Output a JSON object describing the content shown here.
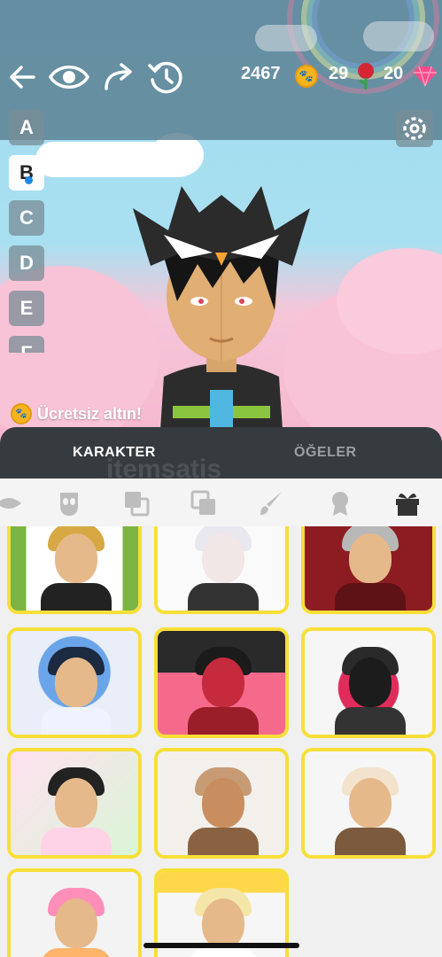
{
  "header": {
    "coins": "2467",
    "roses": "29",
    "gems": "20"
  },
  "letters": [
    "A",
    "B",
    "C",
    "D",
    "E",
    "F"
  ],
  "free_coins_label": "Ücretsiz altın!",
  "tabs": [
    "KARAKTER",
    "ÖĞELER"
  ],
  "watermark": "itemsatis",
  "categories": [
    "lips-icon",
    "mask-icon",
    "layers-icon",
    "layer-front-icon",
    "brush-icon",
    "award-icon",
    "gift-icon"
  ],
  "cards": [
    {
      "theme": "sunflower",
      "hair": "#d7a843",
      "body": "#222"
    },
    {
      "theme": "butterfly",
      "hair": "#e8e8ee",
      "body": "#333"
    },
    {
      "theme": "playing-cards",
      "hair": "#b8b8b8",
      "body": "#7a1c1c"
    },
    {
      "theme": "blue-crown",
      "hair": "#1b2a40",
      "body": "#eef3ff"
    },
    {
      "theme": "red-oni",
      "hair": "#1b1b1b",
      "body": "#c52b3c"
    },
    {
      "theme": "dark-mask",
      "hair": "#2a2a2a",
      "body": "#e02c5b"
    },
    {
      "theme": "candy",
      "hair": "#222",
      "body": "#ffd3e6"
    },
    {
      "theme": "teddy-bear",
      "hair": "#c79b74",
      "body": "#8a6242"
    },
    {
      "theme": "cream-dessert",
      "hair": "#f3e3cc",
      "body": "#7b5a3e"
    },
    {
      "theme": "bunny-pink",
      "hair": "#ff8fb8",
      "body": "#ffb46b"
    },
    {
      "theme": "blonde-cream",
      "hair": "#f4e6a9",
      "body": "#fff"
    }
  ],
  "colors": {
    "accent_yellow": "#f7df37",
    "panel_dark": "#363b3f",
    "coin": "#f5b41e",
    "rose": "#d62535",
    "gem": "#ff4b8b"
  }
}
